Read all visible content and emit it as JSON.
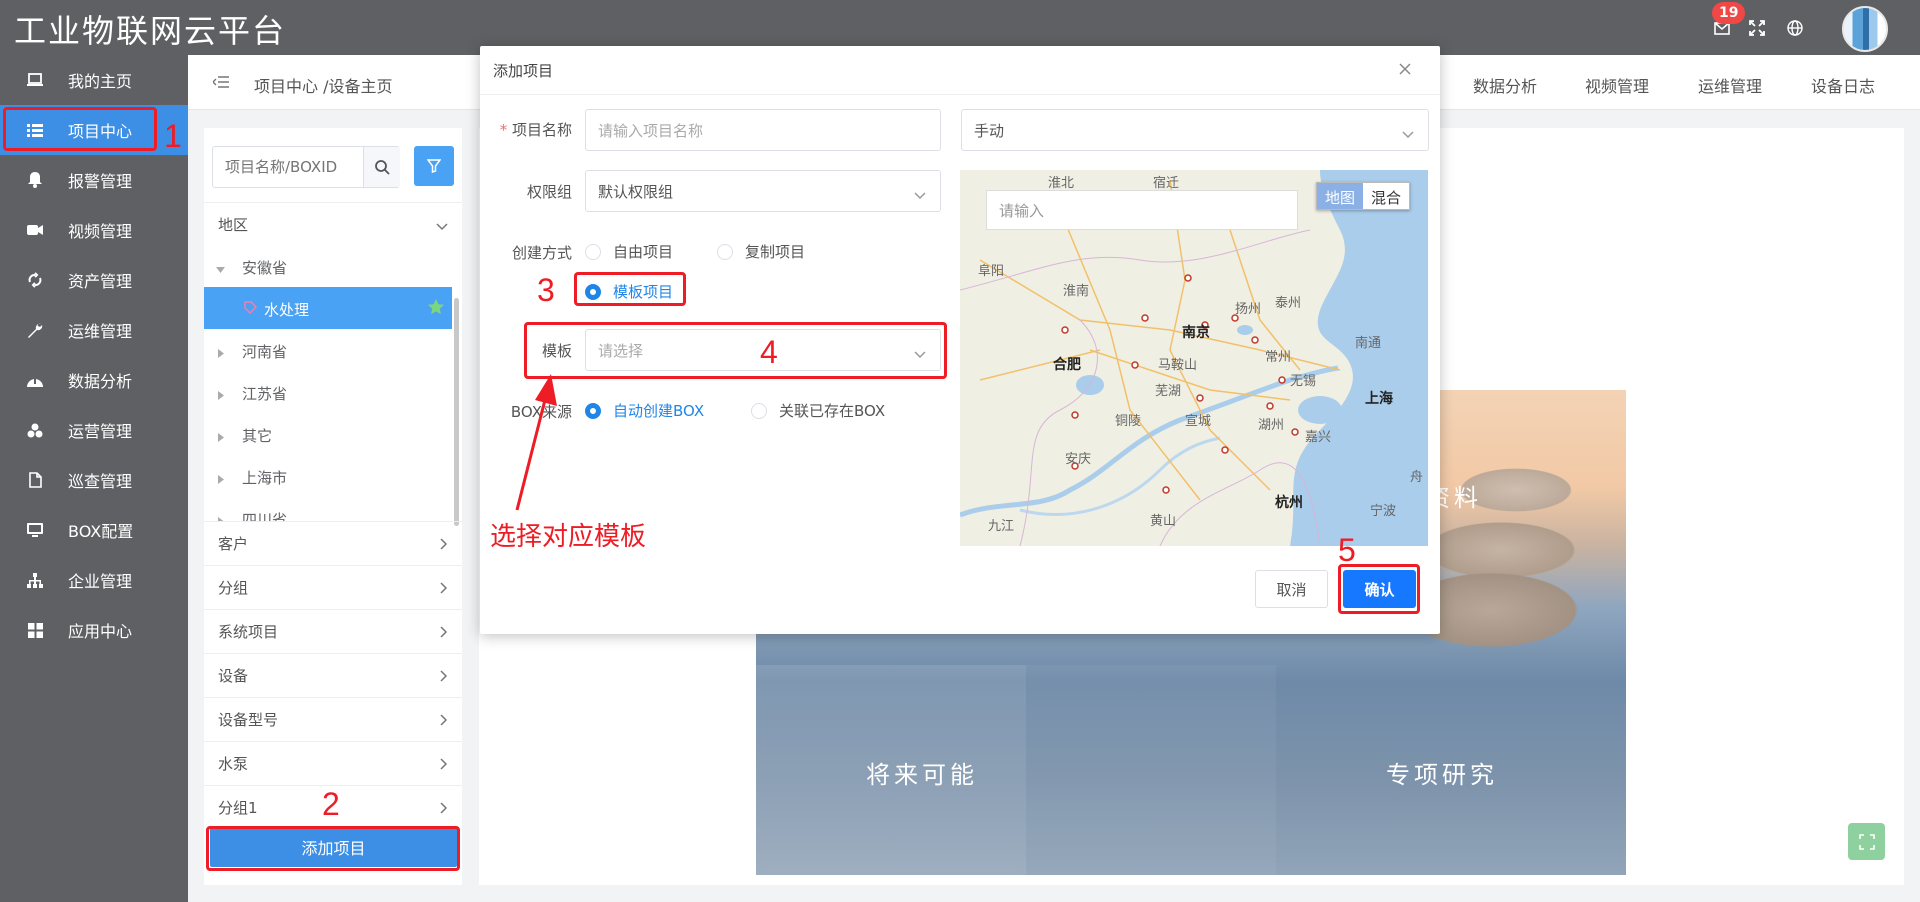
{
  "app": {
    "title": "工业物联网云平台",
    "notification_count": "19"
  },
  "sidenav": {
    "items": [
      {
        "label": "我的主页",
        "icon": "laptop-icon"
      },
      {
        "label": "项目中心",
        "icon": "list-icon"
      },
      {
        "label": "报警管理",
        "icon": "bell-icon"
      },
      {
        "label": "视频管理",
        "icon": "video-icon"
      },
      {
        "label": "资产管理",
        "icon": "recycle-icon"
      },
      {
        "label": "运维管理",
        "icon": "wrench-icon"
      },
      {
        "label": "数据分析",
        "icon": "chart-icon"
      },
      {
        "label": "运营管理",
        "icon": "cubes-icon"
      },
      {
        "label": "巡查管理",
        "icon": "document-icon"
      },
      {
        "label": "BOX配置",
        "icon": "monitor-icon"
      },
      {
        "label": "企业管理",
        "icon": "org-icon"
      },
      {
        "label": "应用中心",
        "icon": "grid-icon"
      }
    ],
    "active_index": 1
  },
  "breadcrumb": "项目中心 /设备主页",
  "top_tabs": [
    "数据分析",
    "视频管理",
    "运维管理",
    "设备日志"
  ],
  "left_panel": {
    "search_placeholder": "项目名称/BOXID",
    "region_header": "地区",
    "tree": [
      {
        "label": "安徽省",
        "expanded": true
      },
      {
        "label": "水处理",
        "selected": true
      },
      {
        "label": "河南省"
      },
      {
        "label": "江苏省"
      },
      {
        "label": "其它"
      },
      {
        "label": "上海市"
      },
      {
        "label": "四川省"
      }
    ],
    "sections": [
      "客户",
      "分组",
      "系统项目",
      "设备",
      "设备型号",
      "水泵",
      "分组1"
    ],
    "add_button": "添加项目"
  },
  "photo_text": {
    "t1": "资料",
    "t2": "将来可能",
    "t3": "专项研究"
  },
  "dialog": {
    "title": "添加项目",
    "fields": {
      "name_label": "项目名称",
      "name_placeholder": "请输入项目名称",
      "mode_value": "手动",
      "group_label": "权限组",
      "group_value": "默认权限组",
      "create_label": "创建方式",
      "create_options": [
        "自由项目",
        "复制项目",
        "模板项目"
      ],
      "create_selected": "模板项目",
      "template_label": "模板",
      "template_placeholder": "请选择",
      "box_label": "BOX来源",
      "box_options": [
        "自动创建BOX",
        "关联已存在BOX"
      ],
      "box_selected": "自动创建BOX"
    },
    "map": {
      "search_placeholder": "请输入",
      "toggle": [
        "地图",
        "混合"
      ],
      "cities": [
        "淮北",
        "宿迁",
        "阜阳",
        "淮南",
        "扬州",
        "泰州",
        "南京",
        "南通",
        "合肥",
        "马鞍山",
        "常州",
        "无锡",
        "芜湖",
        "上海",
        "铜陵",
        "宣城",
        "湖州",
        "嘉兴",
        "安庆",
        "杭州",
        "黄山",
        "九江",
        "宁波",
        "舟"
      ]
    },
    "cancel": "取消",
    "confirm": "确认"
  },
  "annotations": {
    "n1": "1",
    "n2": "2",
    "n3": "3",
    "n4": "4",
    "n5": "5",
    "hint": "选择对应模板",
    "color": "#ee1c25"
  },
  "colors": {
    "primary": "#3d8fe6",
    "sidebar": "#5f6063",
    "danger": "#f04747"
  }
}
